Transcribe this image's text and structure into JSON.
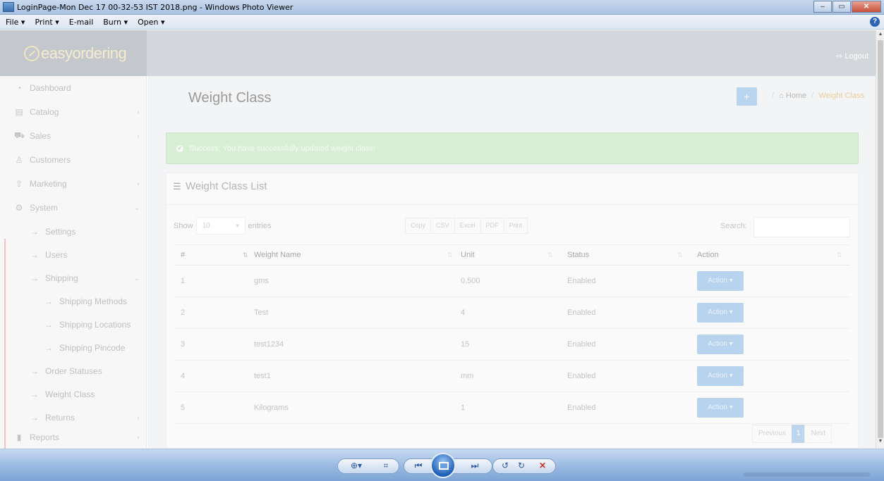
{
  "window": {
    "title": "LoginPage-Mon Dec 17 00-32-53 IST 2018.png - Windows Photo Viewer",
    "controls": {
      "minimize": "–",
      "maximize": "▭",
      "close": "✕"
    }
  },
  "menu": {
    "file": "File ▾",
    "print": "Print ▾",
    "email": "E-mail",
    "burn": "Burn ▾",
    "open": "Open ▾",
    "help": "?"
  },
  "app": {
    "logo_text": "easyordering",
    "logout_label": "⇨ Logout",
    "colors": {
      "alert_bg": "#d8eed5",
      "accent": "#b8d3ed",
      "breadcrumb_current": "#e8cf9a"
    }
  },
  "sidebar": {
    "items": [
      {
        "label": "Dashboard",
        "icon": "dashboard-icon",
        "glyph": "◔"
      },
      {
        "label": "Catalog",
        "icon": "catalog-icon",
        "glyph": "▤",
        "chevron": "‹"
      },
      {
        "label": "Sales",
        "icon": "cart-icon",
        "glyph": "⛟",
        "chevron": "‹"
      },
      {
        "label": "Customers",
        "icon": "user-icon",
        "glyph": "♙"
      },
      {
        "label": "Marketing",
        "icon": "marketing-icon",
        "glyph": "⇧",
        "chevron": "‹"
      },
      {
        "label": "System",
        "icon": "gear-icon",
        "glyph": "⚙",
        "chevron": "⌄"
      },
      {
        "label": "Settings",
        "icon": "arrow-right-icon",
        "glyph": "→"
      },
      {
        "label": "Users",
        "icon": "arrow-right-icon",
        "glyph": "→"
      },
      {
        "label": "Shipping",
        "icon": "arrow-right-icon",
        "glyph": "→",
        "chevron": "⌄"
      },
      {
        "label": "Shipping Methods",
        "icon": "arrow-right-icon",
        "glyph": "→"
      },
      {
        "label": "Shipping Locations",
        "icon": "arrow-right-icon",
        "glyph": "→"
      },
      {
        "label": "Shipping Pincode",
        "icon": "arrow-right-icon",
        "glyph": "→"
      },
      {
        "label": "Order Statuses",
        "icon": "arrow-right-icon",
        "glyph": "→"
      },
      {
        "label": "Weight Class",
        "icon": "arrow-right-icon",
        "glyph": "→"
      },
      {
        "label": "Returns",
        "icon": "arrow-right-icon",
        "glyph": "→",
        "chevron": "‹"
      },
      {
        "label": "Reports",
        "icon": "bar-chart-icon",
        "glyph": "▮",
        "chevron": "‹"
      }
    ]
  },
  "page": {
    "title": "Weight Class",
    "add_label": "+",
    "breadcrumb": {
      "home": "⌂ Home",
      "separator": "/",
      "current": "Weight Class"
    }
  },
  "alert": {
    "icon_glyph": "✔",
    "text": "Success: You have successfully updated weight class!"
  },
  "panel": {
    "title_icon": "☰",
    "title": "Weight Class List",
    "show_label": "Show",
    "entries_label": "entries",
    "length_value": "10",
    "length_caret": "▾",
    "export_buttons": [
      "Copy",
      "CSV",
      "Excel",
      "PDF",
      "Print"
    ],
    "search_label": "Search:",
    "search_value": ""
  },
  "table": {
    "headers": {
      "num": "#",
      "name": "Weight Name",
      "unit": "Unit",
      "status": "Status",
      "action": "Action"
    },
    "sort_glyph": "⇅",
    "action_label": "Action ▾",
    "rows": [
      {
        "num": "1",
        "name": "gms",
        "unit": "0.500",
        "status": "Enabled"
      },
      {
        "num": "2",
        "name": "Test",
        "unit": "4",
        "status": "Enabled"
      },
      {
        "num": "3",
        "name": "test1234",
        "unit": "15",
        "status": "Enabled"
      },
      {
        "num": "4",
        "name": "test1",
        "unit": "mm",
        "status": "Enabled"
      },
      {
        "num": "5",
        "name": "Kilograms",
        "unit": "1",
        "status": "Enabled"
      }
    ]
  },
  "pagination": {
    "previous": "Previous",
    "current": "1",
    "next": "Next"
  },
  "viewer": {
    "zoom_glyph": "⊕▾",
    "fit_glyph": "⌗",
    "prev_glyph": "⏮",
    "next_glyph": "⏭",
    "rotate_ccw_glyph": "↺",
    "rotate_cw_glyph": "↻",
    "delete_glyph": "✕"
  }
}
